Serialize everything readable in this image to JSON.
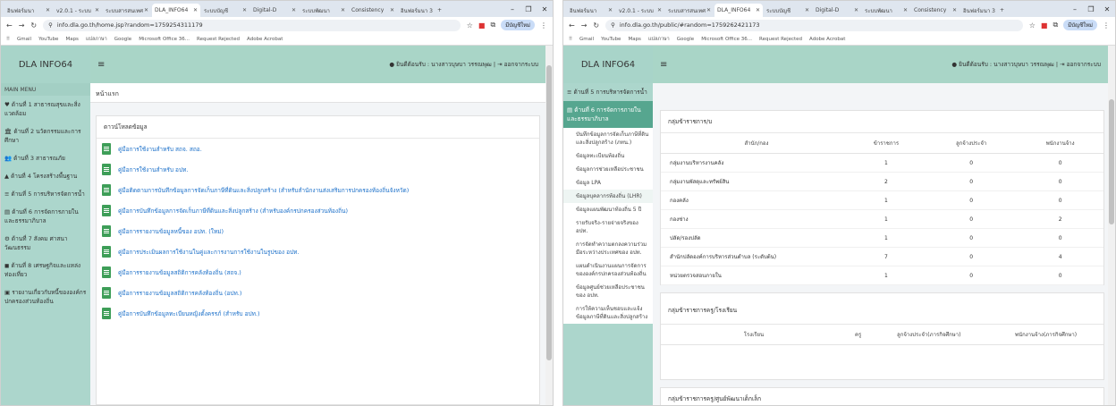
{
  "browser": {
    "tabs": [
      {
        "label": "อินฟอร์มนา"
      },
      {
        "label": "v2.0.1 - ระบบ"
      },
      {
        "label": "ระบบสารสนเทศ"
      },
      {
        "label": "DLA_INFO64"
      },
      {
        "label": "ระบบบัญชี"
      },
      {
        "label": "Digital-D"
      },
      {
        "label": "ระบบพัฒนา"
      },
      {
        "label": "Consistency"
      },
      {
        "label": "อินฟอร์มนา 3"
      }
    ],
    "new_tab": "+",
    "window_controls": {
      "min": "–",
      "max": "❐",
      "close": "✕"
    },
    "profile_label": "มีบัญชีใหม่",
    "bookmarks": [
      "Gmail",
      "YouTube",
      "Maps",
      "แปลภาษา",
      "Google",
      "Microsoft Office 36...",
      "Request Rejected",
      "Adobe Acrobat"
    ]
  },
  "left": {
    "url": "info.dla.go.th/home.jsp?random=1759254311179",
    "brand": "DLA INFO64",
    "hamburger": "≡",
    "user_text": "ยินดีต้อนรับ : นางสาวบุษบา วรรณพุฒ",
    "logout": "ออกจากระบบ",
    "menu_header": "MAIN MENU",
    "menu": [
      {
        "icon": "♥",
        "label": "ด้านที่ 1 สาธารณสุขและสิ่งแวดล้อม"
      },
      {
        "icon": "🏛",
        "label": "ด้านที่ 2 นวัตกรรมและการศึกษา"
      },
      {
        "icon": "👥",
        "label": "ด้านที่ 3 สาธารณภัย"
      },
      {
        "icon": "▲",
        "label": "ด้านที่ 4 โครงสร้างพื้นฐาน"
      },
      {
        "icon": "≡",
        "label": "ด้านที่ 5 การบริหารจัดการน้ำ"
      },
      {
        "icon": "▤",
        "label": "ด้านที่ 6 การจัดการภายในและธรรมาภิบาล"
      },
      {
        "icon": "⚙",
        "label": "ด้านที่ 7 สังคม ศาสนา วัฒนธรรม"
      },
      {
        "icon": "◼",
        "label": "ด้านที่ 8 เศรษฐกิจและแหล่งท่องเที่ยว"
      },
      {
        "icon": "▣",
        "label": "รายงานเกี่ยวกับหนี้ขององค์กรปกครองส่วนท้องถิ่น"
      }
    ],
    "breadcrumb": "หน้าแรก",
    "panel_title": "ดาวน์โหลดข้อมูล",
    "documents": [
      "คู่มือการใช้งานสำหรับ สถจ. สถอ.",
      "คู่มือการใช้งานสำหรับ อปท.",
      "คู่มือติดตามการบันทึกข้อมูลการจัดเก็บภาษีที่ดินและสิ่งปลูกสร้าง (สำหรับสำนักงานส่งเสริมการปกครองท้องถิ่นจังหวัด)",
      "คู่มือการบันทึกข้อมูลการจัดเก็บภาษีที่ดินและสิ่งปลูกสร้าง (สำหรับองค์กรปกครองส่วนท้องถิ่น)",
      "คู่มือการรายงานข้อมูลหนี้ของ อปท. (ใหม่)",
      "คู่มือการประเมินผลการใช้งานในคู่และการงานการใช้งานในรูปของ อปท.",
      "คู่มือการรายงานข้อมูลสถิติการคลังท้องถิ่น (สถจ.)",
      "คู่มือการรายงานข้อมูลสถิติการคลังท้องถิ่น (อปท.)",
      "คู่มือการบันทึกข้อมูลทะเบียนหญิงตั้งครรภ์ (สำหรับ อปท.)"
    ]
  },
  "right": {
    "url": "info.dla.go.th/public/#random=1759262421173",
    "brand": "DLA INFO64",
    "hamburger": "≡",
    "user_text": "ยินดีต้อนรับ : นางสาวบุษบา วรรณพุฒ",
    "logout": "ออกจากระบบ",
    "menu": [
      {
        "icon": "≡",
        "label": "ด้านที่ 5 การบริหารจัดการน้ำ"
      },
      {
        "icon": "▤",
        "label": "ด้านที่ 6 การจัดการภายในและธรรมาภิบาล"
      }
    ],
    "submenu": [
      "บันทึกข้อมูลการจัดเก็บภาษีที่ดินและสิ่งปลูกสร้าง (ภทน.)",
      "ข้อมูลทะเบียนท้องถิ่น",
      "ข้อมูลการช่วยเหลือประชาชน",
      "ข้อมูล LPA",
      "ข้อมูลบุคลากรท้องถิ่น (LHR)",
      "ข้อมูลแผนพัฒนาท้องถิ่น 5 ปี",
      "รายรับจริง-รายจ่ายจริงของ อปท.",
      "การจัดทำความตกลงความร่วมมือระหว่างประเทศของ อปท.",
      "แผนดำเนินงานแผนการจัดการขององค์กรปกครองส่วนท้องถิ่น",
      "ข้อมูลศูนย์ช่วยเหลือประชาชนของ อปท.",
      "การให้ความเห็นชอบและแจ้งข้อมูลภาษีที่ดินและสิ่งปลูกสร้าง"
    ],
    "group1": {
      "title": "กลุ่มข้าราชการ/บ",
      "headers": [
        "สำนัก/กอง",
        "ข้าราชการ",
        "ลูกจ้างประจำ",
        "พนักงานจ้าง"
      ],
      "rows": [
        [
          "กลุ่มงานบริหารงานคลัง",
          "1",
          "0",
          "0"
        ],
        [
          "กลุ่มงานพัสดุและทรัพย์สิน",
          "2",
          "0",
          "0"
        ],
        [
          "กองคลัง",
          "1",
          "0",
          "0"
        ],
        [
          "กองช่าง",
          "1",
          "0",
          "2"
        ],
        [
          "ปลัด/รองปลัด",
          "1",
          "0",
          "0"
        ],
        [
          "สำนักปลัดองค์การบริหารส่วนตำบล (ระดับต้น)",
          "7",
          "0",
          "4"
        ],
        [
          "หน่วยตรวจสอบภายใน",
          "1",
          "0",
          "0"
        ]
      ]
    },
    "group2": {
      "title": "กลุ่มข้าราชการครู/โรงเรียน",
      "headers": [
        "โรงเรียน",
        "ครู",
        "ลูกจ้างประจำ(ภารกิจศึกษา)",
        "พนักงานจ้าง(ภารกิจศึกษา)"
      ]
    },
    "group3": {
      "title": "กลุ่มข้าราชการครู/ศูนย์พัฒนาเด็กเล็ก"
    }
  }
}
